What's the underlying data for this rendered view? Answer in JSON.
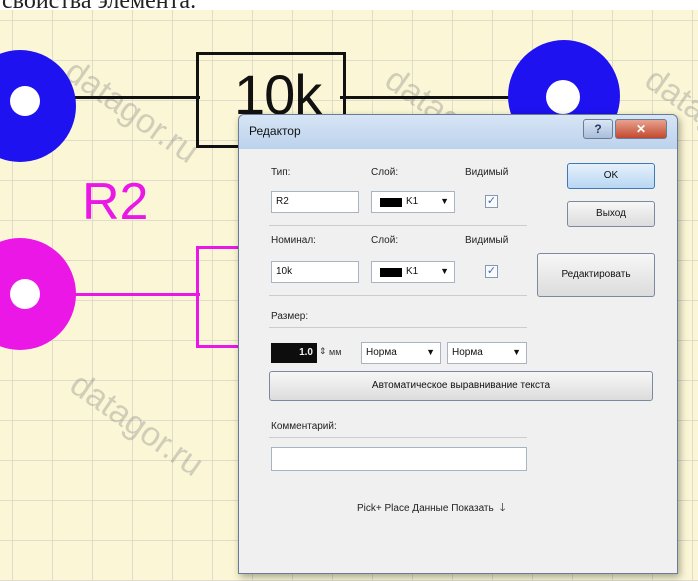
{
  "page": {
    "caption": "свойства элемента."
  },
  "schematic": {
    "component_value_text": "10k",
    "designator_text": "R2",
    "watermark": "datagor.ru",
    "colors": {
      "pad_primary": "#1e12f0",
      "pad_secondary": "#ea17e6",
      "background": "#fbf7d6"
    }
  },
  "dialog": {
    "title": "Редактор",
    "help_glyph": "?",
    "close_glyph": "✕",
    "ok_label": "OK",
    "exit_label": "Выход",
    "edit_label": "Редактировать",
    "type": {
      "label": "Тип:",
      "value": "R2",
      "layer_label": "Слой:",
      "layer_value": "K1",
      "visible_label": "Видимый",
      "visible_checked": true
    },
    "nominal": {
      "label": "Номинал:",
      "value": "10k",
      "layer_label": "Слой:",
      "layer_value": "K1",
      "visible_label": "Видимый",
      "visible_checked": true
    },
    "size": {
      "label": "Размер:",
      "value": "1.0",
      "unit": "мм",
      "style1": "Норма",
      "style2": "Норма"
    },
    "auto_align_label": "Автоматическое выравнивание текста",
    "comment": {
      "label": "Комментарий:",
      "value": ""
    },
    "pick_place_label": "Pick+ Place Данные Показать",
    "pick_place_arrow": "🡓",
    "dropdown_arrow": "▼",
    "spin_glyph": "⇕",
    "check_glyph": "✓"
  }
}
